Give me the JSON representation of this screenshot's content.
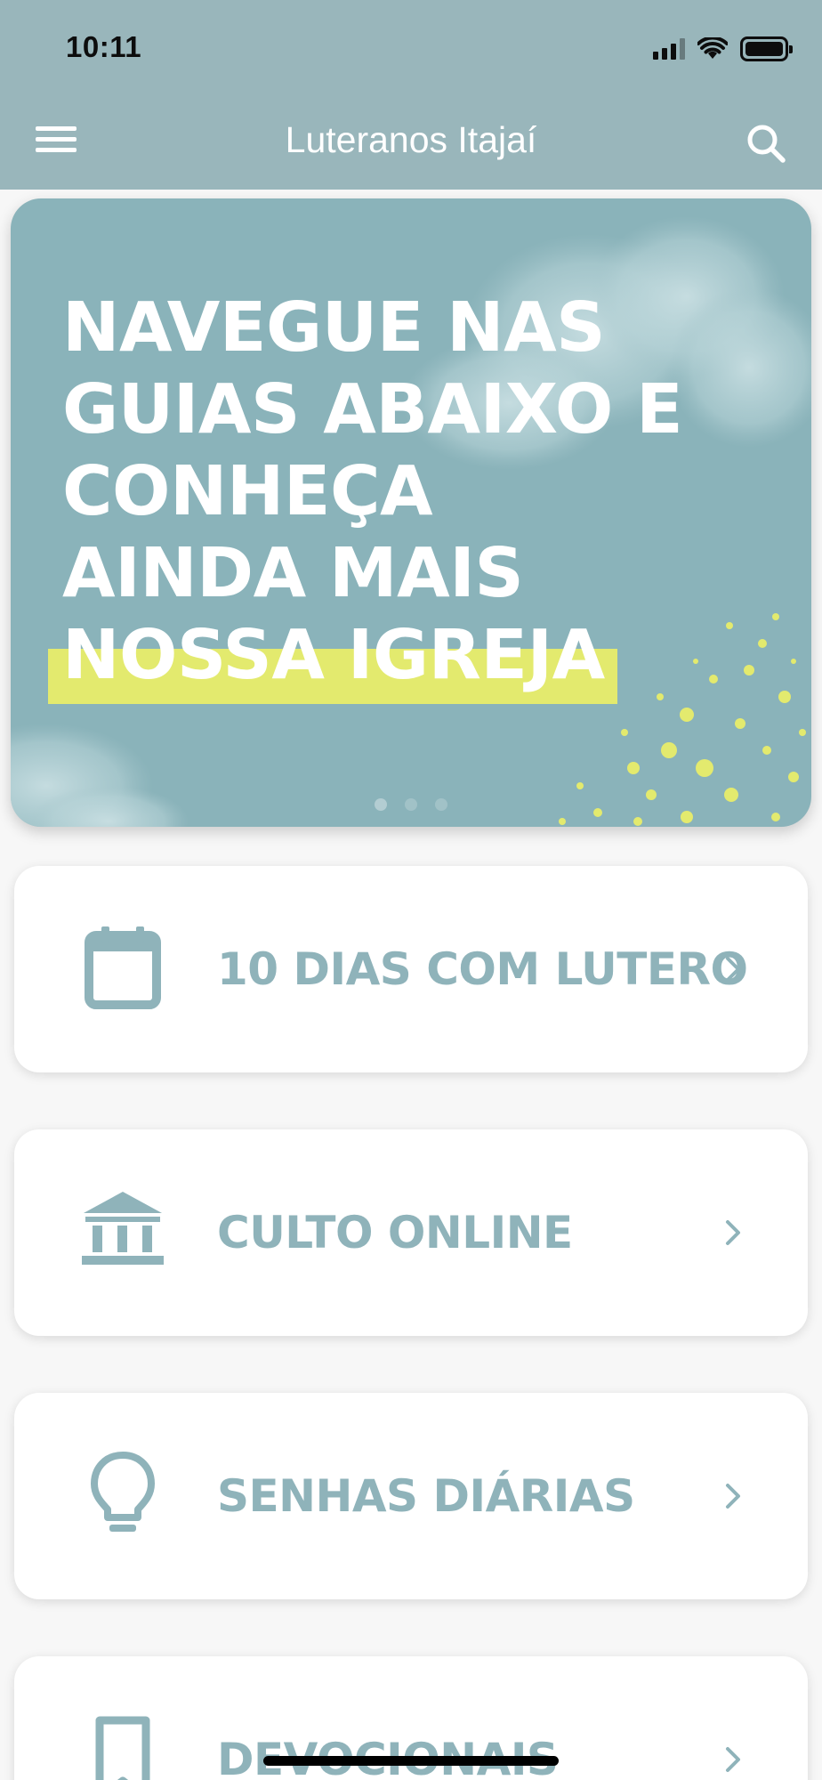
{
  "status_bar": {
    "time": "10:11"
  },
  "app_bar": {
    "title": "Luteranos Itajaí",
    "menu_icon": "hamburger-menu-icon",
    "search_icon": "search-icon"
  },
  "hero": {
    "lines": [
      "NAVEGUE NAS",
      "GUIAS ABAIXO E",
      "CONHEÇA",
      "AINDA MAIS",
      "NOSSA IGREJA"
    ],
    "highlight_color": "#e3ea6e",
    "background_color": "#8ab3ba",
    "page_count": 3,
    "active_page": 1
  },
  "menu_cards": [
    {
      "label": "10 DIAS COM LUTERO",
      "icon": "calendar-icon"
    },
    {
      "label": "CULTO ONLINE",
      "icon": "church-building-icon"
    },
    {
      "label": "SENHAS DIÁRIAS",
      "icon": "lightbulb-icon"
    },
    {
      "label": "DEVOCIONAIS",
      "icon": "bookmark-icon"
    }
  ],
  "colors": {
    "app_bar": "#99b6bb",
    "accent": "#8fb3ba",
    "background": "#f7f7f7"
  }
}
